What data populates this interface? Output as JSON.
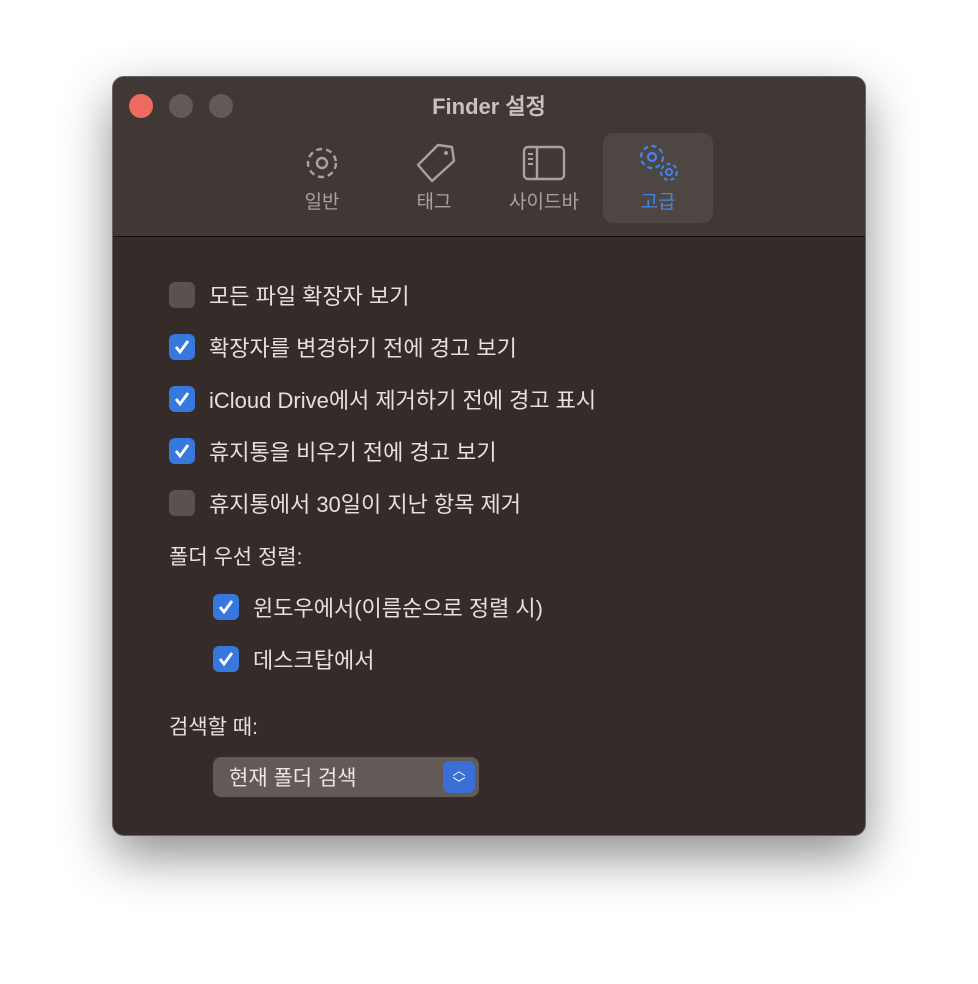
{
  "window": {
    "title": "Finder 설정"
  },
  "tabs": [
    {
      "label": "일반",
      "icon": "gear-icon"
    },
    {
      "label": "태그",
      "icon": "tag-icon"
    },
    {
      "label": "사이드바",
      "icon": "sidebar-icon"
    },
    {
      "label": "고급",
      "icon": "gears-icon",
      "active": true
    }
  ],
  "options": [
    {
      "label": "모든 파일 확장자 보기",
      "checked": false
    },
    {
      "label": "확장자를 변경하기 전에 경고 보기",
      "checked": true
    },
    {
      "label": "iCloud Drive에서 제거하기 전에 경고 표시",
      "checked": true
    },
    {
      "label": "휴지통을 비우기 전에 경고 보기",
      "checked": true
    },
    {
      "label": "휴지통에서 30일이 지난 항목 제거",
      "checked": false
    }
  ],
  "folders_first": {
    "label": "폴더 우선 정렬:",
    "options": [
      {
        "label": "윈도우에서(이름순으로 정렬 시)",
        "checked": true
      },
      {
        "label": "데스크탑에서",
        "checked": true
      }
    ]
  },
  "search": {
    "label": "검색할 때:",
    "value": "현재 폴더 검색"
  },
  "colors": {
    "accent": "#3778de",
    "close": "#ed6a5e"
  }
}
